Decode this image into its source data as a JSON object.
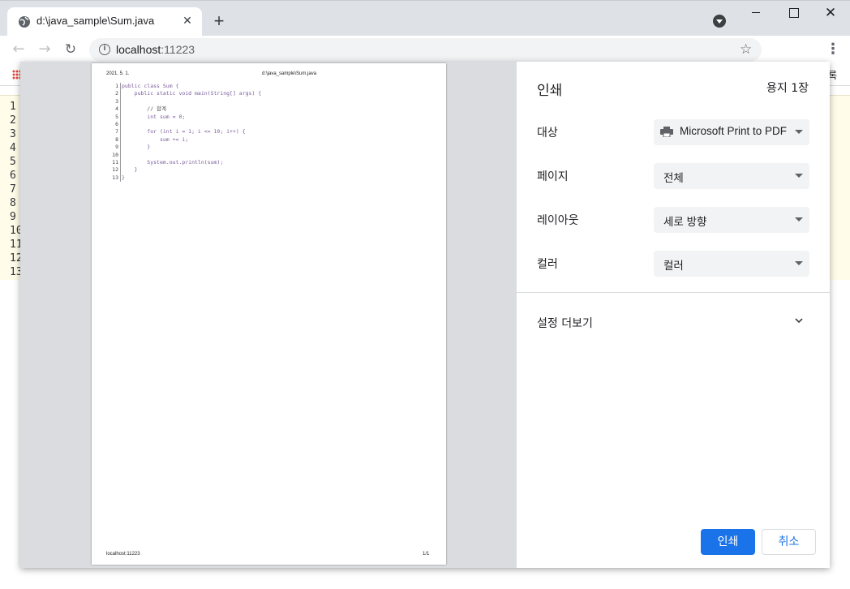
{
  "tab": {
    "title": "d:\\java_sample\\Sum.java"
  },
  "address": {
    "host": "localhost",
    "port": ":11223"
  },
  "bookmarks": {
    "right_text": "록"
  },
  "background_lines": [
    "1",
    "2",
    "3",
    "4",
    "5",
    "6",
    "7",
    "8",
    "9",
    "10",
    "11",
    "12",
    "13"
  ],
  "preview": {
    "date": "2021. 5. 1.",
    "title": "d:\\java_sample\\Sum.java",
    "footer_left": "localhost:11223",
    "footer_right": "1/1",
    "code": [
      {
        "n": "1",
        "t": "public class Sum {",
        "k": "kw"
      },
      {
        "n": "2",
        "t": "    public static void main(String[] args) {",
        "k": "kw"
      },
      {
        "n": "3",
        "t": "",
        "k": "plain"
      },
      {
        "n": "4",
        "t": "        // 합계",
        "k": "comment"
      },
      {
        "n": "5",
        "t": "        int sum = 0;",
        "k": "kw"
      },
      {
        "n": "6",
        "t": "",
        "k": "plain"
      },
      {
        "n": "7",
        "t": "        for (int i = 1; i <= 10; i++) {",
        "k": "kw"
      },
      {
        "n": "8",
        "t": "            sum += i;",
        "k": "kw"
      },
      {
        "n": "9",
        "t": "        }",
        "k": "kw"
      },
      {
        "n": "10",
        "t": "",
        "k": "plain"
      },
      {
        "n": "11",
        "t": "        System.out.println(sum);",
        "k": "kw"
      },
      {
        "n": "12",
        "t": "    }",
        "k": "kw"
      },
      {
        "n": "13",
        "t": "}",
        "k": "kw"
      }
    ]
  },
  "print_panel": {
    "title": "인쇄",
    "sheets": "용지 1장",
    "destination": {
      "label": "대상",
      "value": "Microsoft Print to PDF"
    },
    "pages": {
      "label": "페이지",
      "value": "전체"
    },
    "layout": {
      "label": "레이아웃",
      "value": "세로 방향"
    },
    "color": {
      "label": "컬러",
      "value": "컬러"
    },
    "more_settings": "설정 더보기",
    "print_button": "인쇄",
    "cancel_button": "취소"
  },
  "colors": {
    "accent": "#1a73e8",
    "chrome": "#dee1e6",
    "code_bg": "#fffce9"
  },
  "icons": [
    "globe-icon",
    "close-icon",
    "plus-icon",
    "profile-dropdown-icon",
    "back-icon",
    "forward-icon",
    "reload-icon",
    "info-icon",
    "star-icon",
    "kebab-menu-icon",
    "apps-icon",
    "printer-icon",
    "chevron-down-icon"
  ]
}
